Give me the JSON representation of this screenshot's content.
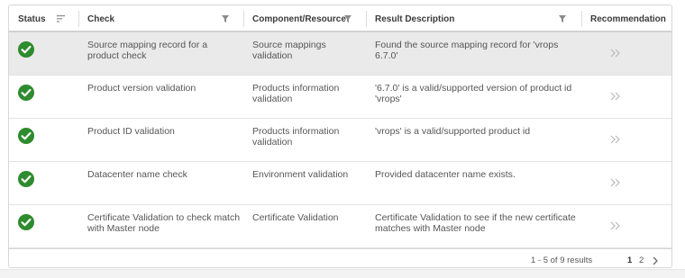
{
  "columns": {
    "status": "Status",
    "check": "Check",
    "component": "Component/Resource",
    "result": "Result Description",
    "recommendation": "Recommendation"
  },
  "rows": [
    {
      "status": "success",
      "check": "Source mapping record for a product check",
      "component": "Source mappings validation",
      "result": "Found the source mapping record for 'vrops 6.7.0'",
      "selected": true
    },
    {
      "status": "success",
      "check": "Product version validation",
      "component": "Products information validation",
      "result": "'6.7.0' is a valid/supported version of product id 'vrops'",
      "selected": false
    },
    {
      "status": "success",
      "check": "Product ID validation",
      "component": "Products information validation",
      "result": "'vrops' is a valid/supported product id",
      "selected": false
    },
    {
      "status": "success",
      "check": "Datacenter name check",
      "component": "Environment validation",
      "result": "Provided datacenter name exists.",
      "selected": false
    },
    {
      "status": "success",
      "check": "Certificate Validation to check match with Master node",
      "component": "Certificate Validation",
      "result": "Certificate Validation to see if the new certificate matches with Master node",
      "selected": false
    }
  ],
  "footer": {
    "count": "1 - 5 of 9 results",
    "pages": [
      "1",
      "2"
    ],
    "current_page": "1"
  },
  "icons": {
    "status": "check-circle-icon",
    "recommendation": "double-chevron-right-icon",
    "filter": "filter-icon",
    "sort": "sort-icon",
    "next": "chevron-right-icon"
  },
  "colors": {
    "success": "#2e8b2e",
    "selected_row": "#eaeaea"
  }
}
